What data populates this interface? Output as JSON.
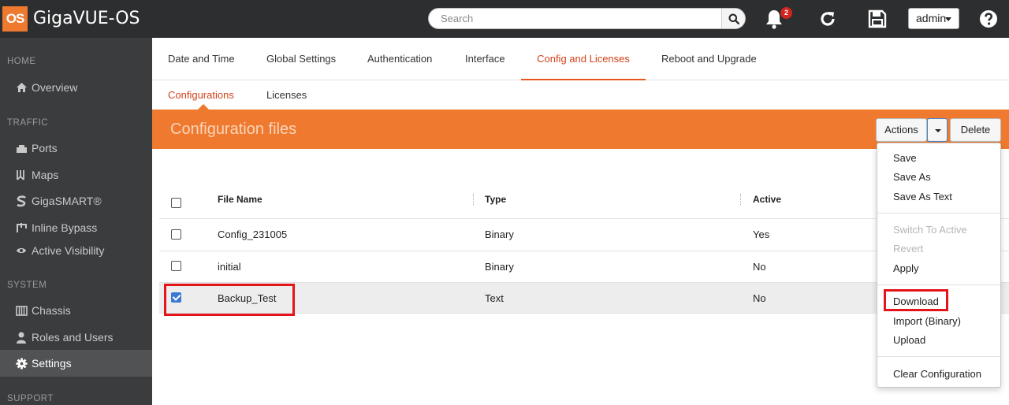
{
  "app": {
    "logo": "OS",
    "title": "GigaVUE-OS"
  },
  "header": {
    "search_placeholder": "Search",
    "notification_count": "2",
    "user": "admin"
  },
  "sidebar": {
    "sections": [
      {
        "label": "HOME"
      },
      {
        "label": "TRAFFIC"
      },
      {
        "label": "SYSTEM"
      },
      {
        "label": "SUPPORT"
      }
    ],
    "items": [
      {
        "label": "Overview",
        "icon": "home-icon"
      },
      {
        "label": "Ports",
        "icon": "ports-icon"
      },
      {
        "label": "Maps",
        "icon": "maps-icon"
      },
      {
        "label": "GigaSMART®",
        "icon": "gigasmart-icon"
      },
      {
        "label": "Inline Bypass",
        "icon": "inline-bypass-icon"
      },
      {
        "label": "Active Visibility",
        "icon": "eye-icon"
      },
      {
        "label": "Chassis",
        "icon": "chassis-icon"
      },
      {
        "label": "Roles and Users",
        "icon": "user-icon"
      },
      {
        "label": "Settings",
        "icon": "gear-icon",
        "active": true
      }
    ]
  },
  "tabs": [
    {
      "label": "Date and Time"
    },
    {
      "label": "Global Settings"
    },
    {
      "label": "Authentication"
    },
    {
      "label": "Interface"
    },
    {
      "label": "Config and Licenses",
      "active": true
    },
    {
      "label": "Reboot and Upgrade"
    }
  ],
  "subtabs": [
    {
      "label": "Configurations",
      "active": true
    },
    {
      "label": "Licenses"
    }
  ],
  "banner": {
    "title": "Configuration files"
  },
  "toolbar": {
    "actions_label": "Actions",
    "delete_label": "Delete"
  },
  "table": {
    "columns": [
      "File Name",
      "Type",
      "Active"
    ],
    "rows": [
      {
        "name": "Config_231005",
        "type": "Binary",
        "active": "Yes",
        "checked": false
      },
      {
        "name": "initial",
        "type": "Binary",
        "active": "No",
        "checked": false
      },
      {
        "name": "Backup_Test",
        "type": "Text",
        "active": "No",
        "checked": true
      }
    ]
  },
  "dropdown": {
    "groups": [
      [
        {
          "label": "Save"
        },
        {
          "label": "Save As"
        },
        {
          "label": "Save As Text"
        }
      ],
      [
        {
          "label": "Switch To Active",
          "disabled": true
        },
        {
          "label": "Revert",
          "disabled": true
        },
        {
          "label": "Apply"
        }
      ],
      [
        {
          "label": "Download",
          "highlighted": true
        },
        {
          "label": "Import (Binary)"
        },
        {
          "label": "Upload"
        }
      ],
      [
        {
          "label": "Clear Configuration"
        }
      ]
    ]
  },
  "colors": {
    "accent": "#ef7a2f",
    "active_tab": "#d2421b",
    "highlight": "#e3141a",
    "sidebar": "#3b3c3e",
    "topbar": "#2d2e30"
  }
}
